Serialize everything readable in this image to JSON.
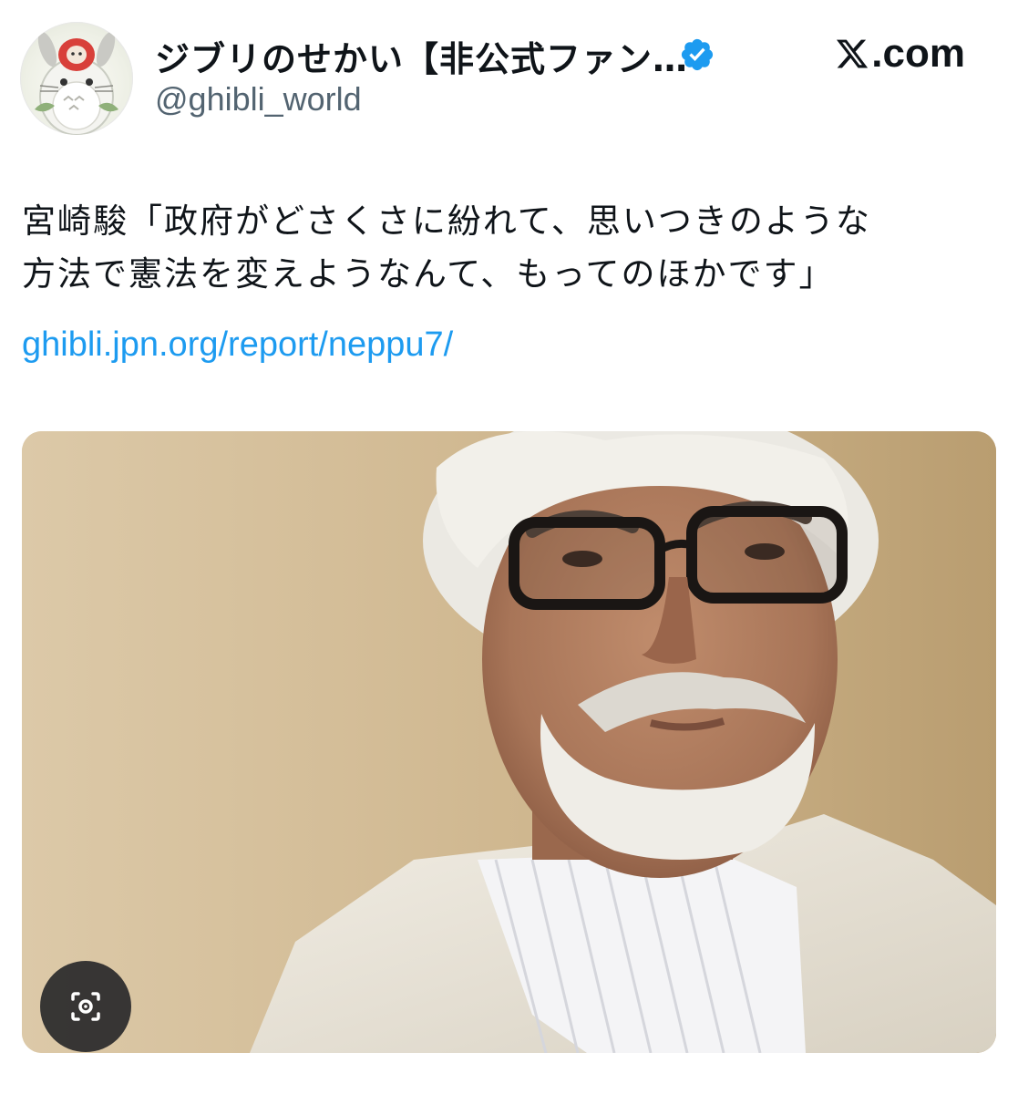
{
  "header": {
    "display_name": "ジブリのせかい【非公式ファン…",
    "handle": "@ghibli_world",
    "verified_icon": "verified-badge-icon",
    "brand": ".com",
    "brand_icon": "x-logo-icon",
    "avatar_alt": "avatar"
  },
  "tweet": {
    "lines": [
      "宮崎駿「政府がどさくさに紛れて、思いつきのような",
      "方法で憲法を変えようなんて、もってのほかです」"
    ],
    "link": "ghibli.jpn.org/report/neppu7/"
  },
  "media": {
    "subject": "portrait photo of an older man with white hair, glasses and a white beard wearing a light jacket"
  },
  "overlay": {
    "lens_icon": "image-search-icon"
  },
  "colors": {
    "link": "#1d9bf0",
    "verified": "#1d9bf0",
    "handle": "#536471",
    "text": "#0f1419"
  }
}
